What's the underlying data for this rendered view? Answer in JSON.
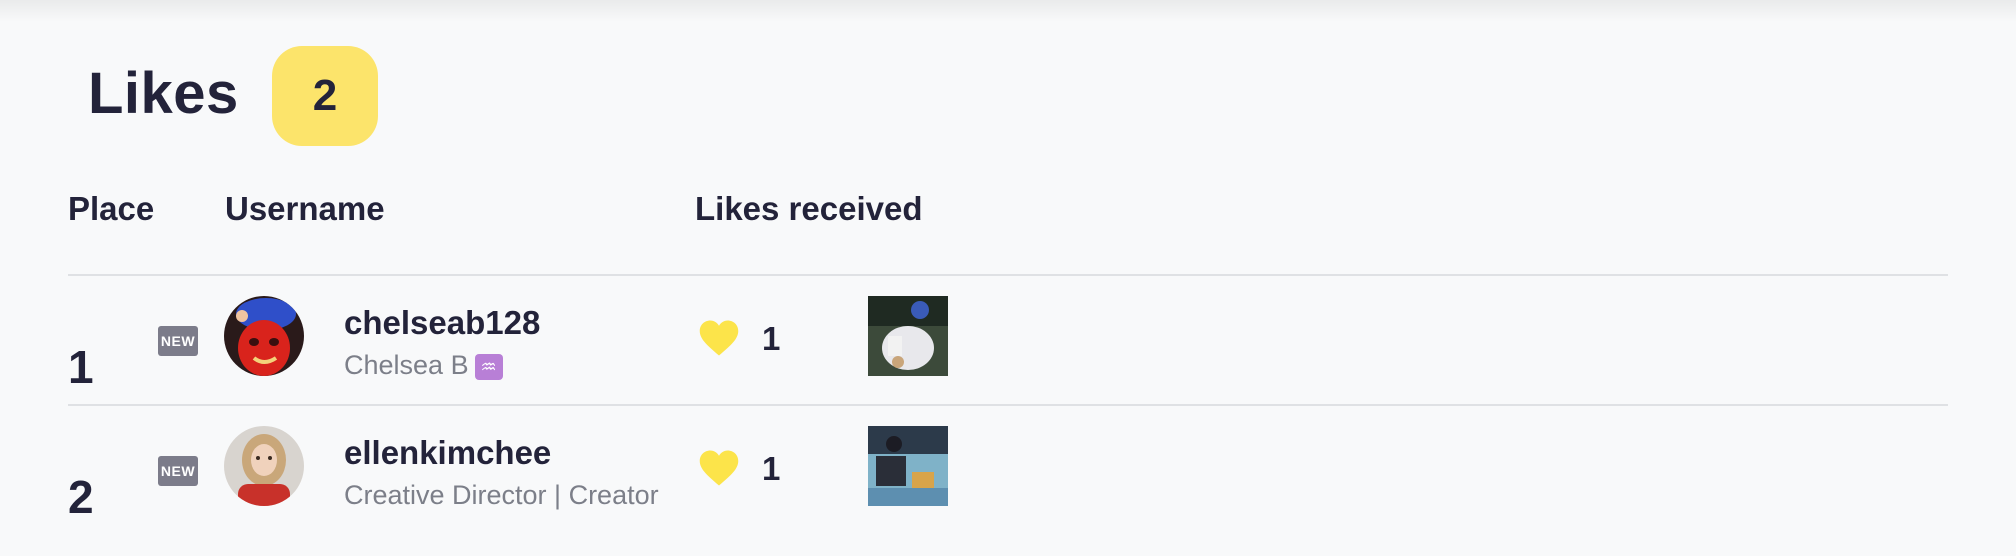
{
  "header": {
    "title": "Likes",
    "count": "2"
  },
  "columns": {
    "place": "Place",
    "username": "Username",
    "likes_received": "Likes received"
  },
  "rows": [
    {
      "place": "1",
      "badge": "NEW",
      "username": "chelseab128",
      "subtitle": "Chelsea B",
      "subtitle_emoji": "♒",
      "likes": "1",
      "avatar_icon": "avatar-photo",
      "thumb_icon": "post-thumbnail"
    },
    {
      "place": "2",
      "badge": "NEW",
      "username": "ellenkimchee",
      "subtitle": "Creative Director | Creator",
      "likes": "1",
      "avatar_icon": "avatar-photo",
      "thumb_icon": "post-thumbnail"
    }
  ],
  "colors": {
    "accent_yellow": "#fce46b",
    "badge_gray": "#7c7c8a",
    "text_dark": "#23233a",
    "text_muted": "#7c7f89"
  }
}
